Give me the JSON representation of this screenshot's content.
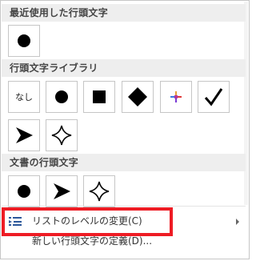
{
  "sections": {
    "recent": {
      "title": "最近使用した行頭文字"
    },
    "library": {
      "title": "行頭文字ライブラリ",
      "none_label": "なし"
    },
    "document": {
      "title": "文書の行頭文字"
    }
  },
  "tiles": {
    "recent": [
      "filled-circle-bullet"
    ],
    "library": [
      "none",
      "filled-circle-bullet",
      "filled-square-bullet",
      "filled-diamond-bullet",
      "four-color-star-bullet",
      "checkmark-bullet",
      "arrowhead-bullet",
      "four-point-star-bullet"
    ],
    "document": [
      "filled-circle-bullet",
      "arrowhead-bullet",
      "four-point-star-bullet"
    ]
  },
  "menu": {
    "change_level": "リストのレベルの変更(C)",
    "define_new": "新しい行頭文字の定義(D)..."
  },
  "colors": {
    "highlight": "#ee1c24",
    "header_bg": "#eeeeee",
    "icon_blue": "#2b579a"
  }
}
